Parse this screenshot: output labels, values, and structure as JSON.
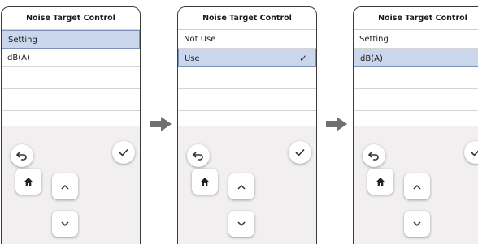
{
  "screens": [
    {
      "title": "Noise Target Control",
      "items": [
        {
          "label": "Setting",
          "selected": true,
          "checked": false
        },
        {
          "label": "dB(A)",
          "selected": false,
          "checked": false
        }
      ]
    },
    {
      "title": "Noise Target Control",
      "items": [
        {
          "label": "Not Use",
          "selected": false,
          "checked": false
        },
        {
          "label": "Use",
          "selected": true,
          "checked": true
        }
      ]
    },
    {
      "title": "Noise Target Control",
      "items": [
        {
          "label": "Setting",
          "selected": false,
          "checked": false
        },
        {
          "label": "dB(A)",
          "selected": true,
          "checked": false
        }
      ]
    }
  ],
  "icons": {
    "back": "back-arrow-icon",
    "confirm": "checkmark-icon",
    "home": "home-icon",
    "up": "chevron-up-icon",
    "down": "chevron-down-icon",
    "transition": "right-arrow-icon"
  },
  "glyphs": {
    "check": "✓",
    "up": "^",
    "down": "v"
  },
  "colors": {
    "selected_bg": "#c9d6ec",
    "selected_border": "#7e93b8",
    "arrow": "#707070",
    "pad_bg": "#f1efef"
  }
}
